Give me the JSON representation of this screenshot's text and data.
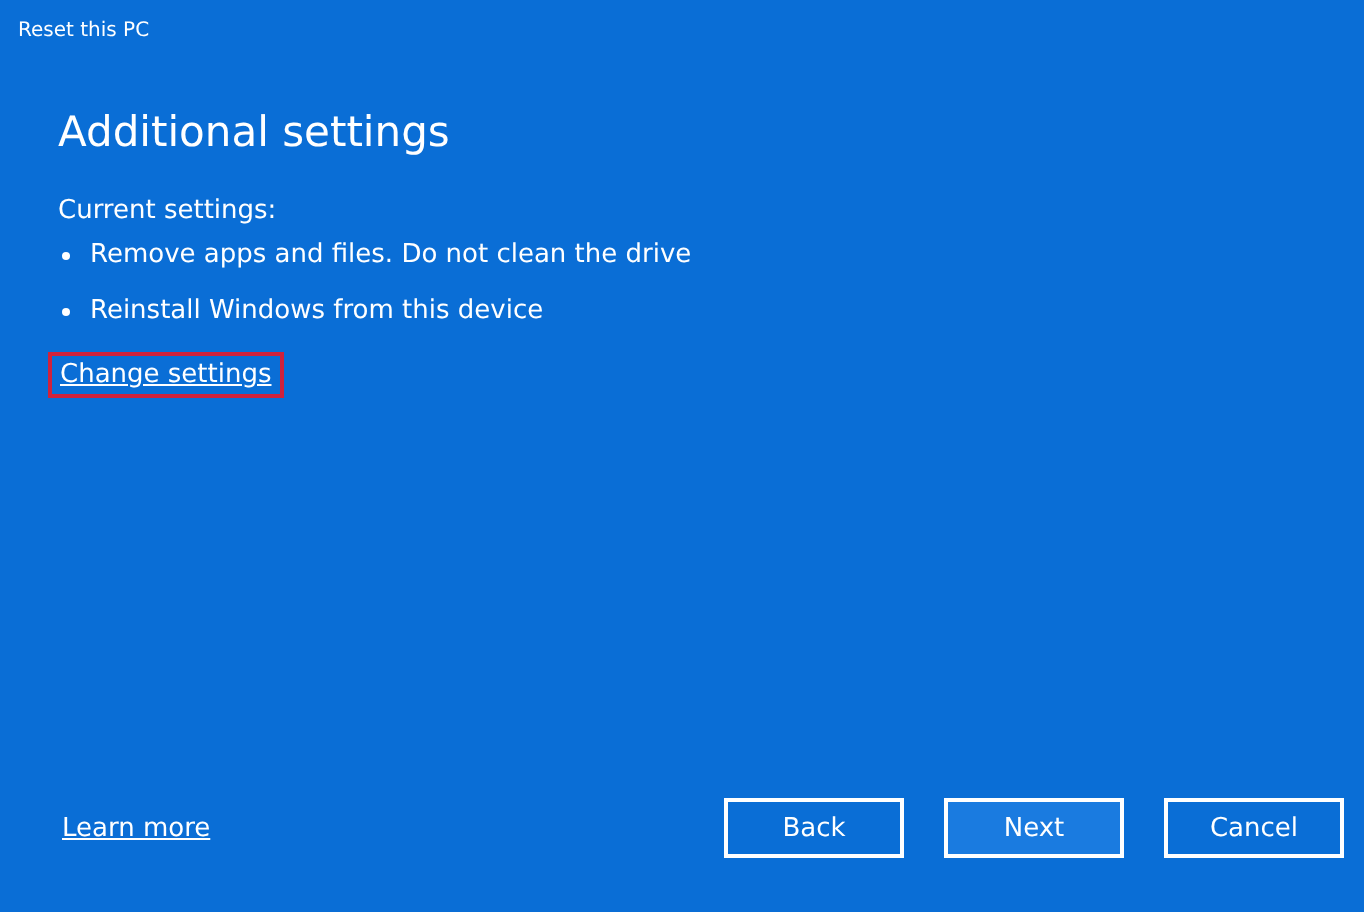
{
  "window": {
    "title": "Reset this PC"
  },
  "heading": "Additional settings",
  "current_label": "Current settings:",
  "settings": [
    "Remove apps and files. Do not clean the drive",
    "Reinstall Windows from this device"
  ],
  "change_link": {
    "label": "Change settings",
    "highlighted": true
  },
  "learn_more": "Learn more",
  "buttons": [
    {
      "label": "Back",
      "default": false
    },
    {
      "label": "Next",
      "default": true
    },
    {
      "label": "Cancel",
      "default": false
    }
  ]
}
